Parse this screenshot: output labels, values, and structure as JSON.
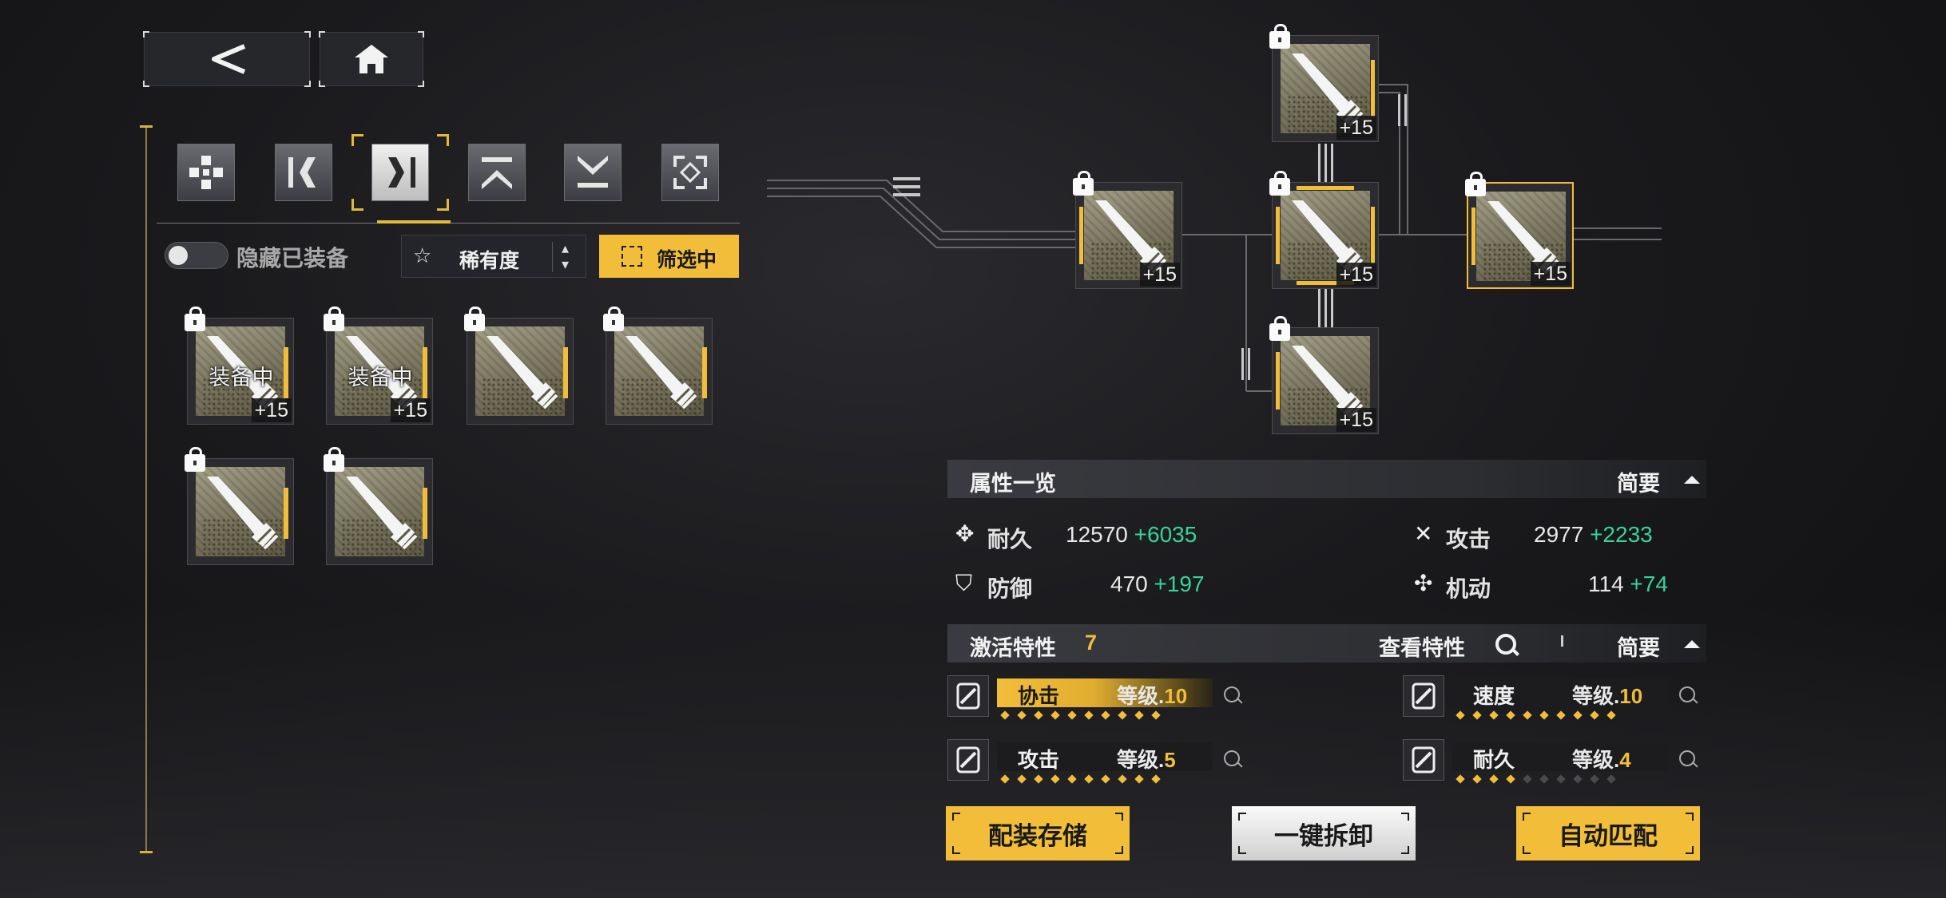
{
  "nav": {
    "back_icon": "chevron-left-icon",
    "home_icon": "home-icon"
  },
  "tabs": [
    {
      "icon": "dpad-cross-icon",
      "active": false
    },
    {
      "icon": "left-bracket-icon",
      "active": false
    },
    {
      "icon": "right-bracket-icon",
      "active": true
    },
    {
      "icon": "chevron-up-icon",
      "active": false
    },
    {
      "icon": "chevron-down-icon",
      "active": false
    },
    {
      "icon": "frame-corners-icon",
      "active": false
    }
  ],
  "filters": {
    "hide_equipped_label": "隐藏已装备",
    "hide_equipped_on": false,
    "sort_label": "稀有度",
    "filter_label": "筛选中"
  },
  "inventory": [
    {
      "status": "装备中",
      "level": "+15",
      "locked": true
    },
    {
      "status": "装备中",
      "level": "+15",
      "locked": true
    },
    {
      "status": "",
      "level": "",
      "locked": true
    },
    {
      "status": "",
      "level": "",
      "locked": true
    },
    {
      "status": "",
      "level": "",
      "locked": true
    },
    {
      "status": "",
      "level": "",
      "locked": true
    }
  ],
  "network_slots": [
    {
      "id": "left",
      "level": "+15"
    },
    {
      "id": "top",
      "level": "+15"
    },
    {
      "id": "center",
      "level": "+15"
    },
    {
      "id": "bottom",
      "level": "+15"
    },
    {
      "id": "right",
      "level": "+15",
      "selected": true
    }
  ],
  "attributes": {
    "header": "属性一览",
    "brief": "简要",
    "durability": {
      "label": "耐久",
      "base": "12570",
      "bonus": "+6035"
    },
    "attack": {
      "label": "攻击",
      "base": "2977",
      "bonus": "+2233"
    },
    "defense": {
      "label": "防御",
      "base": "470",
      "bonus": "+197"
    },
    "mobility": {
      "label": "机动",
      "base": "114",
      "bonus": "+74"
    }
  },
  "traits": {
    "header": "激活特性",
    "count": "7",
    "view_label": "查看特性",
    "brief": "简要",
    "level_prefix": "等级.",
    "items": [
      {
        "name": "协击",
        "level": "10",
        "filled": 10,
        "highlight": true
      },
      {
        "name": "速度",
        "level": "10",
        "filled": 10,
        "highlight": false
      },
      {
        "name": "攻击",
        "level": "5",
        "filled": 10,
        "highlight": false
      },
      {
        "name": "耐久",
        "level": "4",
        "filled": 4,
        "highlight": false
      }
    ]
  },
  "actions": {
    "save_label": "配装存储",
    "unequip_label": "一键拆卸",
    "auto_label": "自动匹配"
  },
  "colors": {
    "accent": "#f2be3a",
    "bonus": "#35d49a",
    "panel": "#2c2d31"
  }
}
